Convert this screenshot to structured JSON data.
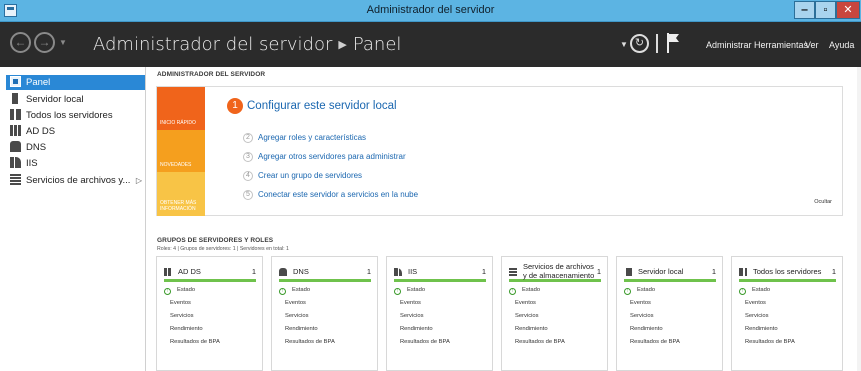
{
  "window": {
    "title": "Administrador del servidor"
  },
  "header": {
    "app": "Administrador del servidor",
    "page": "Panel",
    "menus": [
      "Administrar",
      "Herramientas",
      "Ver",
      "Ayuda"
    ]
  },
  "sidebar": {
    "items": [
      {
        "label": "Panel",
        "icon": "dashboard-icon",
        "active": true
      },
      {
        "label": "Servidor local",
        "icon": "server-icon"
      },
      {
        "label": "Todos los servidores",
        "icon": "servers-icon"
      },
      {
        "label": "AD DS",
        "icon": "adds-icon"
      },
      {
        "label": "DNS",
        "icon": "dns-icon"
      },
      {
        "label": "IIS",
        "icon": "iis-icon"
      },
      {
        "label": "Servicios de archivos y...",
        "icon": "file-services-icon"
      }
    ]
  },
  "welcome": {
    "title": "ADMINISTRADOR DEL SERVIDOR",
    "strips": [
      "INICIO RÁPIDO",
      "NOVEDADES",
      "OBTENER MÁS INFORMACIÓN"
    ],
    "main_step": {
      "num": "1",
      "label": "Configurar este servidor local"
    },
    "steps": [
      {
        "num": "2",
        "label": "Agregar roles y características"
      },
      {
        "num": "3",
        "label": "Agregar otros servidores para administrar"
      },
      {
        "num": "4",
        "label": "Crear un grupo de servidores"
      },
      {
        "num": "5",
        "label": "Conectar este servidor a servicios en la nube"
      }
    ],
    "hide": "Ocultar"
  },
  "roles": {
    "title": "GRUPOS DE SERVIDORES Y ROLES",
    "subtitle": "Roles: 4   |   Grupos de servidores: 1   |   Servidores en total: 1",
    "row_labels": [
      "Estado",
      "Eventos",
      "Servicios",
      "Rendimiento",
      "Resultados de BPA"
    ],
    "tiles": [
      {
        "name": "AD DS",
        "count": "1",
        "icon": "adds-icon"
      },
      {
        "name": "DNS",
        "count": "1",
        "icon": "dns-icon"
      },
      {
        "name": "IIS",
        "count": "1",
        "icon": "iis-icon"
      },
      {
        "name": "Servicios de archivos y de almacenamiento",
        "count": "1",
        "icon": "file-services-icon"
      },
      {
        "name": "Servidor local",
        "count": "1",
        "icon": "server-icon"
      },
      {
        "name": "Todos los servidores",
        "count": "1",
        "icon": "servers-icon"
      }
    ]
  }
}
